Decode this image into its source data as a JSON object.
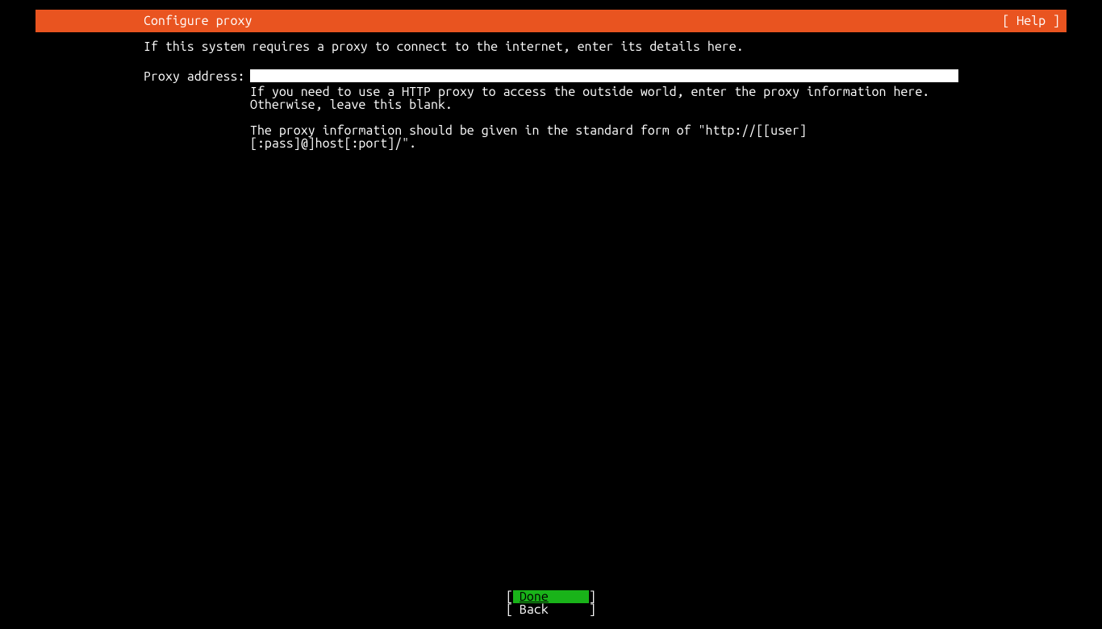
{
  "header": {
    "title": "Configure proxy",
    "help": "[ Help ]"
  },
  "intro": "If this system requires a proxy to connect to the internet, enter its details here.",
  "form": {
    "proxy_label": "Proxy address:",
    "proxy_value": "",
    "help_line1": "If you need to use a HTTP proxy to access the outside world, enter the proxy information here. Otherwise, leave this blank.",
    "help_line2": "The proxy information should be given in the standard form of \"http://[[user][:pass]@]host[:port]/\"."
  },
  "buttons": {
    "done": "Done",
    "back": "Back",
    "bracket_open": "[",
    "bracket_close": "]"
  }
}
